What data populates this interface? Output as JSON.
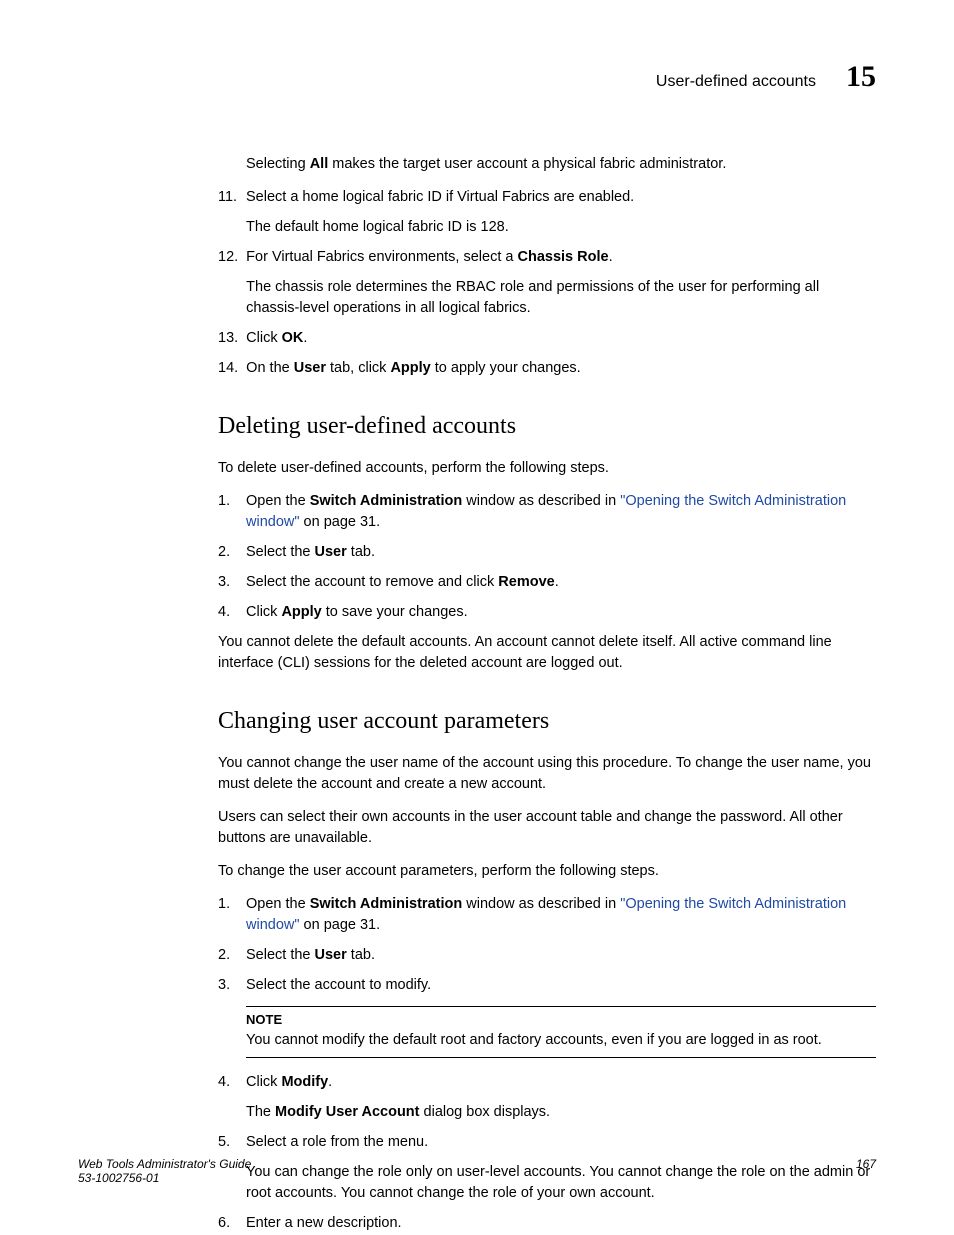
{
  "header": {
    "section_title": "User-defined accounts",
    "chapter_number": "15"
  },
  "intro": {
    "para1_prefix": "Selecting ",
    "para1_bold": "All",
    "para1_suffix": " makes the target user account a physical fabric administrator."
  },
  "steps_a": {
    "s11": {
      "num": "11.",
      "text": "Select a home logical fabric ID if Virtual Fabrics are enabled.",
      "sub": "The default home logical fabric ID is 128."
    },
    "s12": {
      "num": "12.",
      "prefix": "For Virtual Fabrics environments, select a ",
      "bold": "Chassis Role",
      "suffix": ".",
      "sub": "The chassis role determines the RBAC role and permissions of the user for performing all chassis-level operations in all logical fabrics."
    },
    "s13": {
      "num": "13.",
      "prefix": "Click ",
      "bold": "OK",
      "suffix": "."
    },
    "s14": {
      "num": "14.",
      "p1": "On the ",
      "b1": "User",
      "p2": " tab, click ",
      "b2": "Apply",
      "p3": " to apply your changes."
    }
  },
  "section_deleting": {
    "heading": "Deleting user-defined accounts",
    "intro": "To delete user-defined accounts, perform the following steps.",
    "s1": {
      "num": "1.",
      "prefix": "Open the ",
      "bold": "Switch Administration",
      "mid": " window as described in ",
      "link": "\"Opening the Switch Administration window\"",
      "suffix": " on page 31."
    },
    "s2": {
      "num": "2.",
      "prefix": "Select the ",
      "bold": "User",
      "suffix": " tab."
    },
    "s3": {
      "num": "3.",
      "prefix": "Select the account to remove and click ",
      "bold": "Remove",
      "suffix": "."
    },
    "s4": {
      "num": "4.",
      "prefix": "Click ",
      "bold": "Apply",
      "suffix": " to save your changes."
    },
    "outro": "You cannot delete the default accounts. An account cannot delete itself. All active command line interface (CLI) sessions for the deleted account are logged out."
  },
  "section_changing": {
    "heading": "Changing user account parameters",
    "para1": "You cannot change the user name of the account using this procedure. To change the user name, you must delete the account and create a new account.",
    "para2": "Users can select their own accounts in the user account table and change the password. All other buttons are unavailable.",
    "para3": "To change the user account parameters, perform the following steps.",
    "s1": {
      "num": "1.",
      "prefix": "Open the ",
      "bold": "Switch Administration",
      "mid": " window as described in ",
      "link": "\"Opening the Switch Administration window\"",
      "suffix": " on page 31."
    },
    "s2": {
      "num": "2.",
      "prefix": "Select the ",
      "bold": "User",
      "suffix": " tab."
    },
    "s3": {
      "num": "3.",
      "text": "Select the account to modify."
    },
    "note": {
      "label": "NOTE",
      "body": "You cannot modify the default root and factory accounts, even if you are logged in as root."
    },
    "s4": {
      "num": "4.",
      "prefix": "Click ",
      "bold": "Modify",
      "suffix": ".",
      "sub_prefix": "The ",
      "sub_bold": "Modify User Account",
      "sub_suffix": " dialog box displays."
    },
    "s5": {
      "num": "5.",
      "text": "Select a role from the menu.",
      "sub": "You can change the role only on user-level accounts. You cannot change the role on the admin or root accounts. You cannot change the role of your own account."
    },
    "s6": {
      "num": "6.",
      "text": "Enter a new description."
    }
  },
  "footer": {
    "title": "Web Tools Administrator's Guide",
    "docnum": "53-1002756-01",
    "page": "167"
  }
}
